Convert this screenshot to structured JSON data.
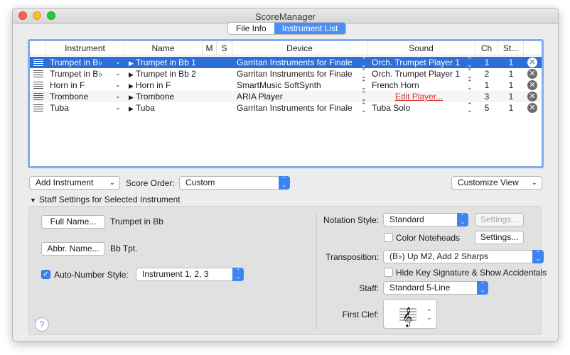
{
  "window": {
    "title": "ScoreManager"
  },
  "tabs": [
    {
      "label": "File Info",
      "active": false
    },
    {
      "label": "Instrument List",
      "active": true
    }
  ],
  "table": {
    "columns": [
      "Instrument",
      "Name",
      "M",
      "S",
      "Device",
      "Sound",
      "Ch",
      "St..."
    ],
    "rows": [
      {
        "instrument": "Trumpet in B♭",
        "name": "Trumpet in Bb 1",
        "device": "Garritan Instruments for Finale",
        "sound": "Orch. Trumpet Player 1",
        "ch": "1",
        "st": "1"
      },
      {
        "instrument": "Trumpet in B♭",
        "name": "Trumpet in Bb 2",
        "device": "Garritan Instruments for Finale",
        "sound": "Orch. Trumpet Player 1",
        "ch": "2",
        "st": "1"
      },
      {
        "instrument": "Horn in F",
        "name": "Horn in F",
        "device": "SmartMusic SoftSynth",
        "sound": "French Horn",
        "ch": "1",
        "st": "1"
      },
      {
        "instrument": "Trombone",
        "name": "Trombone",
        "device": "ARIA Player",
        "sound": "Edit Player...",
        "ch": "3",
        "st": "1"
      },
      {
        "instrument": "Tuba",
        "name": "Tuba",
        "device": "Garritan Instruments for Finale",
        "sound": "Tuba Solo",
        "ch": "5",
        "st": "1"
      }
    ]
  },
  "controls": {
    "add_instrument": "Add Instrument",
    "score_order_label": "Score Order:",
    "score_order_value": "Custom",
    "customize_view": "Customize View"
  },
  "staff_settings": {
    "title": "Staff Settings for Selected Instrument",
    "full_name_button": "Full Name...",
    "full_name_value": "Trumpet in Bb",
    "abbr_name_button": "Abbr. Name...",
    "abbr_name_value": "Bb Tpt.",
    "auto_number_label": "Auto-Number Style:",
    "auto_number_value": "Instrument 1, 2, 3",
    "notation_style_label": "Notation Style:",
    "notation_style_value": "Standard",
    "settings_disabled": "Settings...",
    "color_noteheads_label": "Color Noteheads",
    "settings_button": "Settings...",
    "transposition_label": "Transposition:",
    "transposition_value": "(B♭) Up M2, Add 2 Sharps",
    "hide_key_label": "Hide Key Signature & Show Accidentals",
    "staff_label": "Staff:",
    "staff_value": "Standard 5-Line",
    "first_clef_label": "First Clef:",
    "help": "?"
  },
  "colors": {
    "accent": "#3d84f0",
    "selection": "#2d6ed8",
    "link": "#d9302c"
  }
}
